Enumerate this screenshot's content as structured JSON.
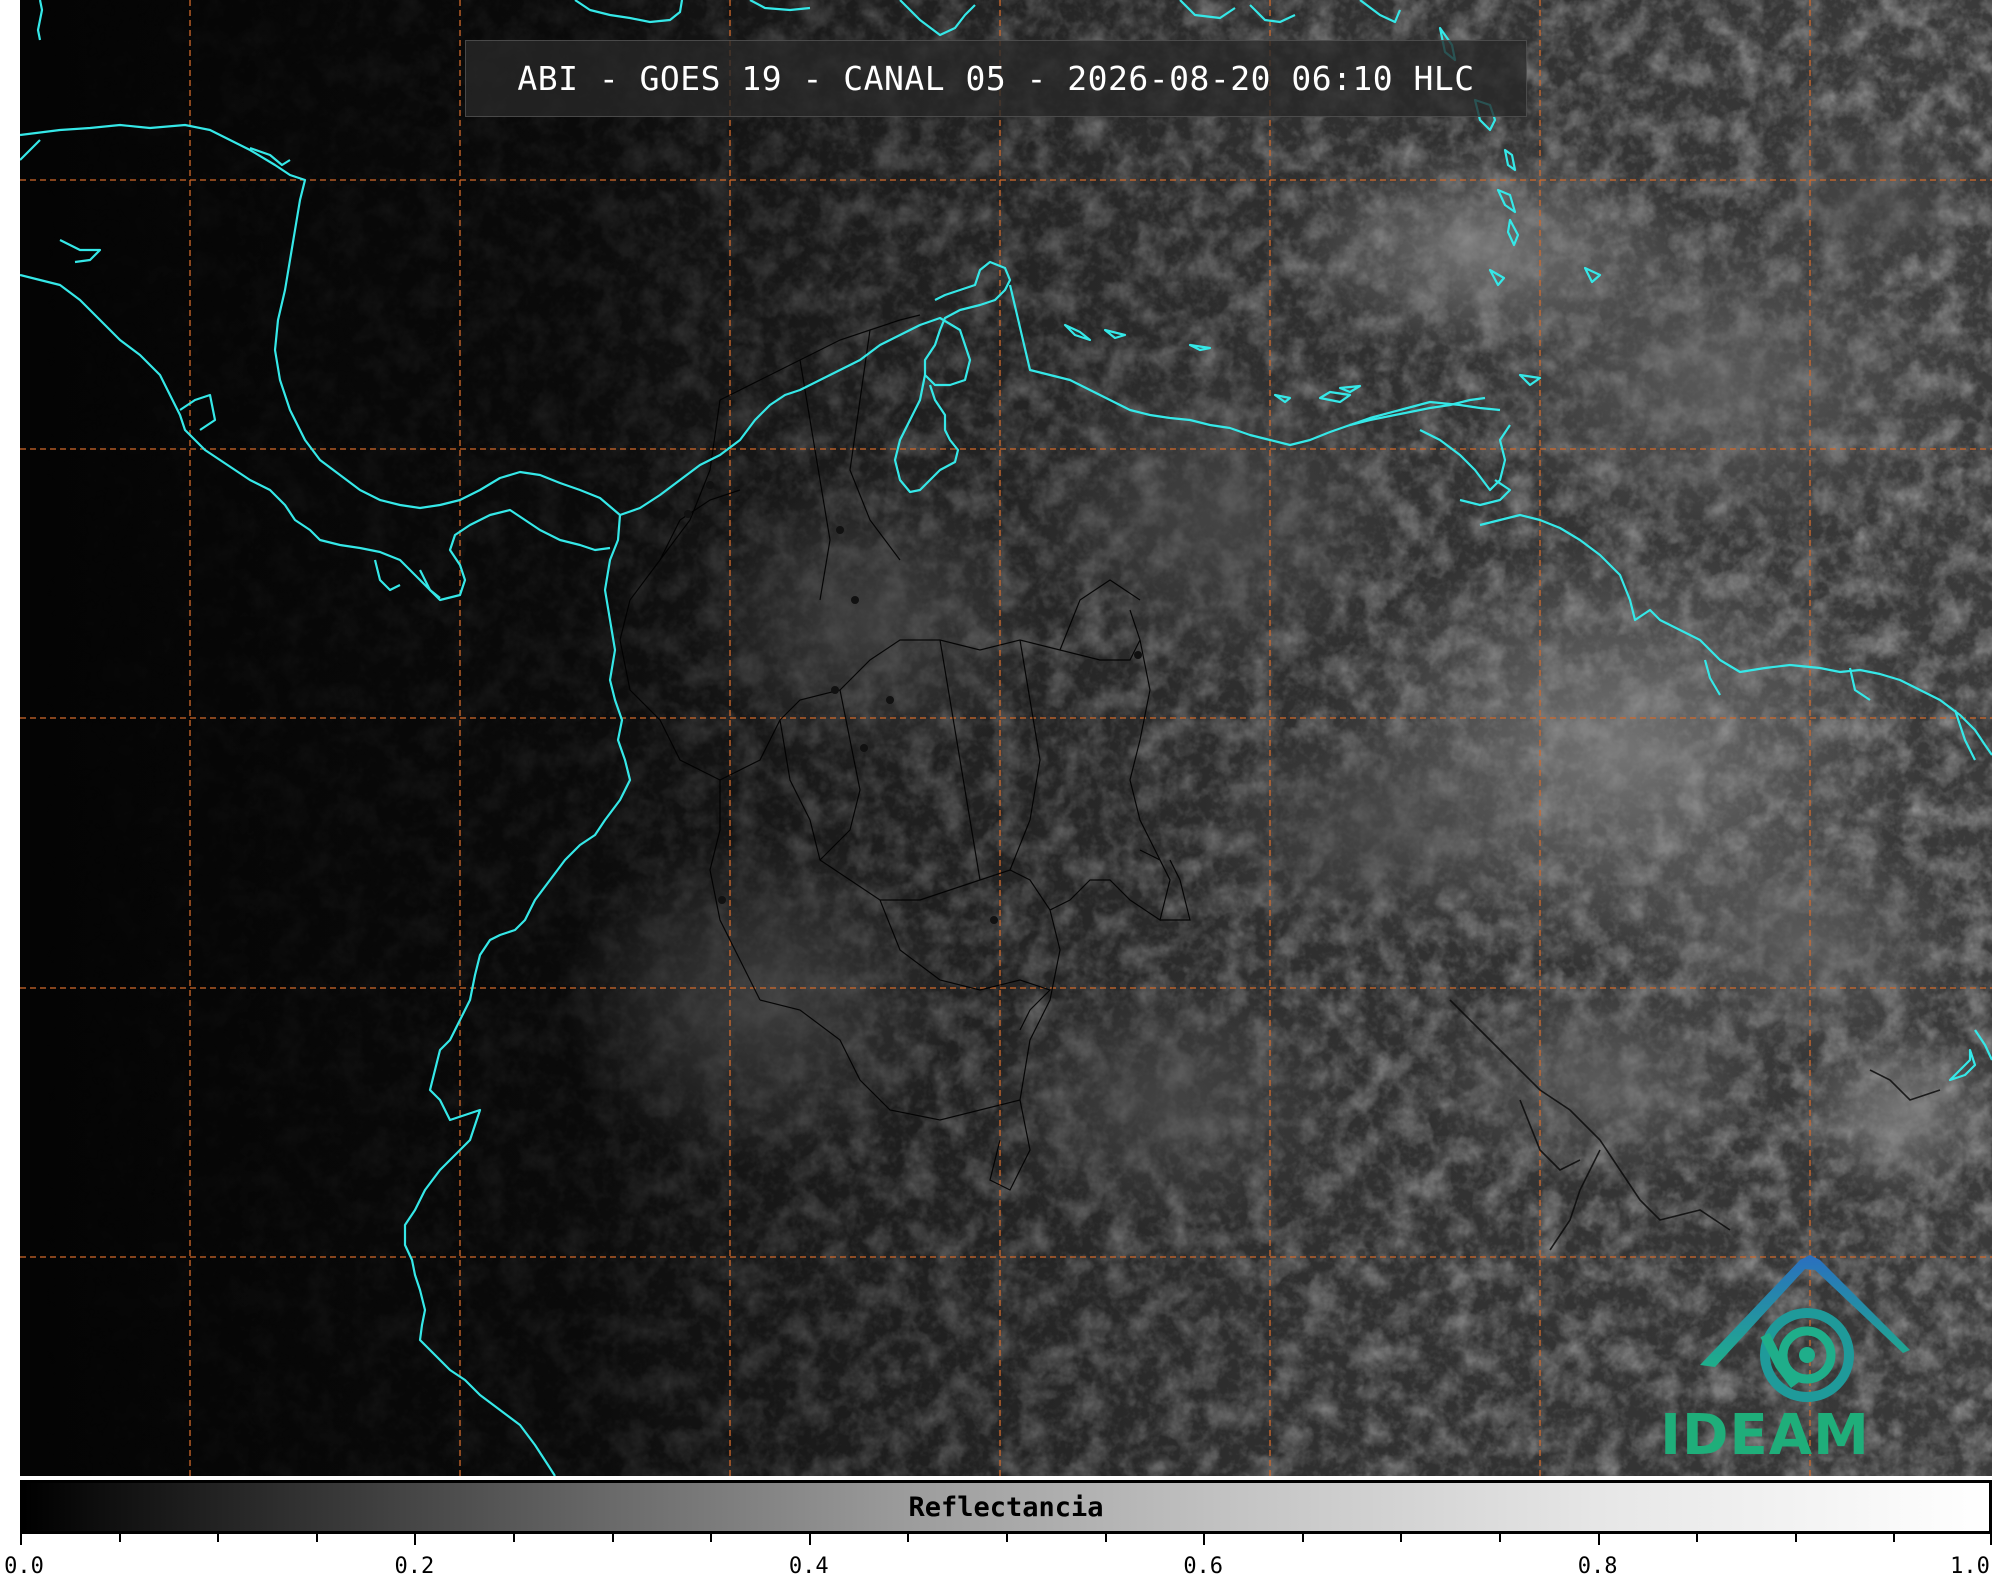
{
  "title": "ABI - GOES 19 - CANAL 05 - 2026-08-20 06:10 HLC",
  "colorbar": {
    "label": "Reflectancia",
    "min": 0.0,
    "max": 1.0,
    "tick_labels": [
      "0.0",
      "0.2",
      "0.4",
      "0.6",
      "0.8",
      "1.0"
    ],
    "colormap": "grayscale"
  },
  "logo": {
    "text": "IDEAM",
    "color": "#1fae7a"
  },
  "map": {
    "coastline_color": "#35e8e8",
    "gridline_color": "#d2692a",
    "border_color": "#000000",
    "gridlines": "dashed"
  }
}
